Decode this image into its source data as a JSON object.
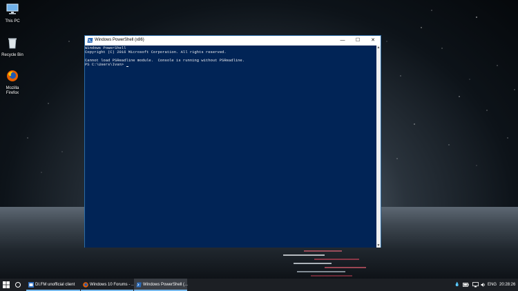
{
  "desktop": {
    "icons": [
      {
        "label": "This PC",
        "icon": "this-pc-icon"
      },
      {
        "label": "Recycle Bin",
        "icon": "recycle-bin-icon"
      },
      {
        "label": "Mozilla Firefox",
        "icon": "firefox-icon"
      }
    ]
  },
  "window": {
    "title": "Windows PowerShell (x86)",
    "controls": {
      "minimize": "—",
      "maximize": "☐",
      "close": "✕"
    },
    "console_lines": [
      "Windows PowerShell",
      "Copyright (C) 2016 Microsoft Corporation. All rights reserved.",
      "",
      "Cannot load PSReadline module.  Console is running without PSReadline.",
      "PS C:\\Users\\Ivan> "
    ]
  },
  "taskbar": {
    "tasks": [
      {
        "label": "DI.FM unofficial client",
        "icon": "difm-icon"
      },
      {
        "label": "Windows 10 Forums - ...",
        "icon": "firefox-icon"
      },
      {
        "label": "Windows PowerShell (...",
        "icon": "powershell-icon"
      }
    ],
    "tray": {
      "language": "ENG",
      "time": "20:28:26"
    }
  },
  "colors": {
    "console_bg": "#012456",
    "accent": "#76b9ed"
  }
}
